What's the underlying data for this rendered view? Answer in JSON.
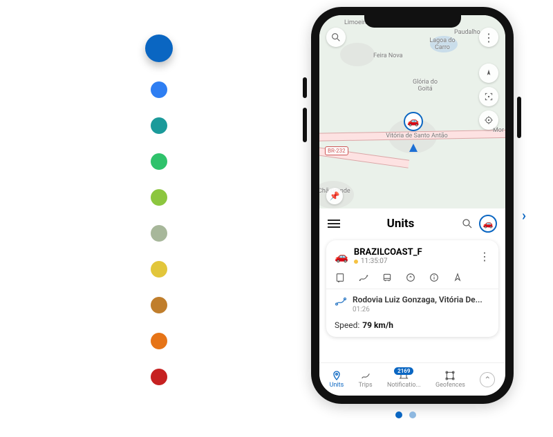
{
  "palette": {
    "colors": [
      "#0a66c2",
      "#2e7ef2",
      "#1b9a9a",
      "#2fc26b",
      "#8cc63f",
      "#a7b79a",
      "#e2c63b",
      "#c07e2c",
      "#e67417",
      "#c62121"
    ],
    "selected_index": 0
  },
  "map": {
    "labels": {
      "top1": "Limoeiro",
      "top2": "Paudalho",
      "lagoa": "Lagoa do Carro",
      "feira": "Feira Nova",
      "gloria": "Glória do Goitá",
      "center": "Vitória de Santo Antão",
      "cha": "Chã Grande",
      "mor": "Mor"
    },
    "road_badge": "BR-232"
  },
  "panel": {
    "title": "Units"
  },
  "unit": {
    "name": "BRAZILCOAST_F",
    "time": "11:35:07",
    "trip_address": "Rodovia Luiz Gonzaga, Vitória De...",
    "trip_time": "01:26",
    "speed_label": "Speed:",
    "speed_value": "79 km/h"
  },
  "bottom_nav": {
    "items": [
      {
        "label": "Units",
        "icon": "pin",
        "active": true
      },
      {
        "label": "Trips",
        "icon": "route",
        "active": false
      },
      {
        "label": "Notificatio...",
        "icon": "bell",
        "active": false,
        "badge": "2169"
      },
      {
        "label": "Geofences",
        "icon": "shape",
        "active": false
      }
    ]
  },
  "carousel": {
    "current": 0,
    "count": 2
  }
}
